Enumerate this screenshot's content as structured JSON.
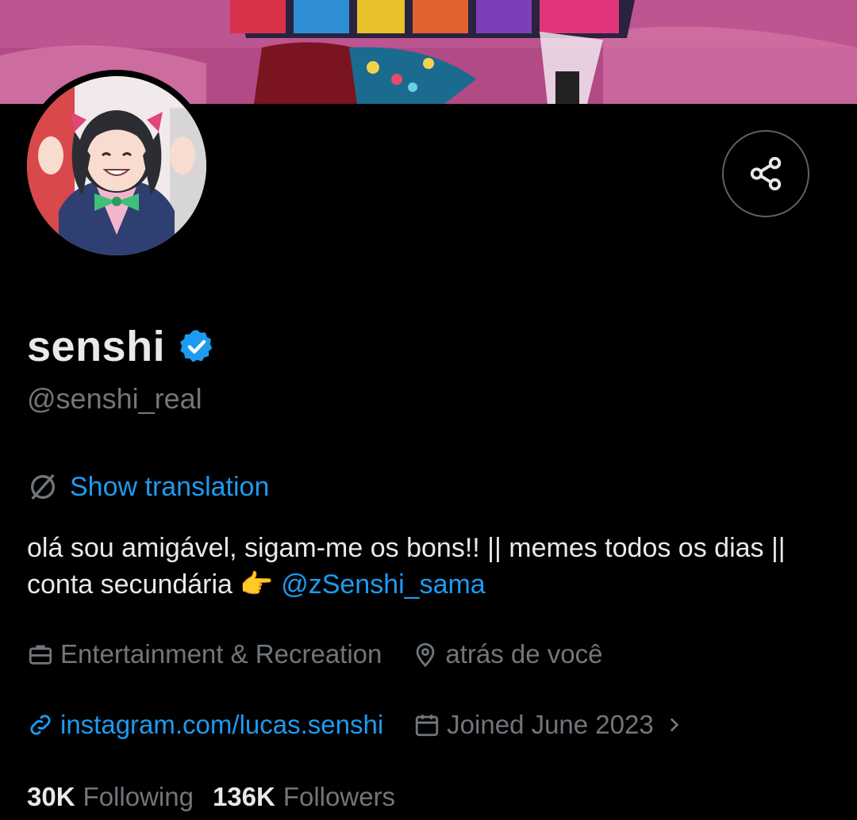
{
  "profile": {
    "display_name": "senshi",
    "handle": "@senshi_real",
    "verified": true
  },
  "translation": {
    "label": "Show translation"
  },
  "bio": {
    "text": "olá sou amigável, sigam-me os bons!!  || memes todos os dias || conta secundária 👉 ",
    "mention": "@zSenshi_sama"
  },
  "meta": {
    "category": "Entertainment & Recreation",
    "location": "atrás de você",
    "link": "instagram.com/lucas.senshi",
    "joined": "Joined June 2023"
  },
  "stats": {
    "following_count": "30K",
    "following_label": "Following",
    "followers_count": "136K",
    "followers_label": "Followers"
  },
  "icons": {
    "share": "share-icon",
    "verified": "verified-badge-icon",
    "translate": "translate-icon",
    "category": "briefcase-icon",
    "location": "location-pin-icon",
    "link": "link-icon",
    "joined": "calendar-icon",
    "chevron": "chevron-right-icon"
  },
  "colors": {
    "accent": "#1d9bf0",
    "muted": "#71767b",
    "text": "#e7e9ea",
    "background": "#000000"
  }
}
